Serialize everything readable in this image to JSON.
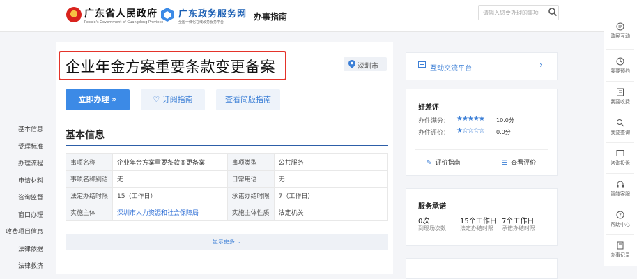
{
  "header": {
    "gov_name": "广东省人民政府",
    "gov_sub": "People's Government of Guangdong Province",
    "service_name": "广东政务服务网",
    "service_sub": "全国一体化在线政务服务平台",
    "nav_guide": "办事指南",
    "search_placeholder": "请输入您要办理的事项",
    "brand_color": "#1a5fb4",
    "icons": [
      "emblem-icon",
      "gd-logo-icon",
      "search-icon"
    ]
  },
  "main": {
    "title": "企业年金方案重要条款变更备案",
    "location": "深圳市",
    "actions": {
      "apply": "立即办理 »",
      "subscribe": "订阅指南",
      "simple": "查看简版指南"
    },
    "section_title": "基本信息",
    "info_rows": [
      [
        "事项名称",
        "企业年金方案重要条款变更备案",
        "事项类型",
        "公共服务"
      ],
      [
        "事项名称别语",
        "无",
        "日常用语",
        "无"
      ],
      [
        "法定办结时限",
        "15（工作日）",
        "承诺办结时限",
        "7（工作日）"
      ],
      [
        "实施主体",
        "深圳市人力资源和社会保障局",
        "实施主体性质",
        "法定机关"
      ]
    ],
    "show_more": "显示更多"
  },
  "left_nav": [
    "基本信息",
    "受理标准",
    "办理流程",
    "申请材料",
    "咨询监督",
    "窗口办理",
    "收费项目信息",
    "法律依据",
    "法律救济"
  ],
  "sidebar": {
    "interaction": "互动交流平台",
    "rating": {
      "title": "好差评",
      "rows": [
        {
          "label": "办件满分：",
          "stars": "★★★★★",
          "score": "10.0分"
        },
        {
          "label": "办件评价：",
          "stars": "★☆☆☆☆",
          "score": "0.0分"
        }
      ],
      "guide_link": "评价指南",
      "view_link": "查看评价"
    },
    "promise": {
      "title": "服务承诺",
      "items": [
        {
          "value": "0次",
          "label": "到现场次数"
        },
        {
          "value": "15个工作日",
          "label": "法定办结时限"
        },
        {
          "value": "7个工作日",
          "label": "承诺办结时限"
        }
      ]
    }
  },
  "right_rail": [
    "政民互动",
    "我要预约",
    "我要收费",
    "我要查询",
    "咨询投诉",
    "智能客服",
    "帮助中心",
    "办事记录"
  ]
}
